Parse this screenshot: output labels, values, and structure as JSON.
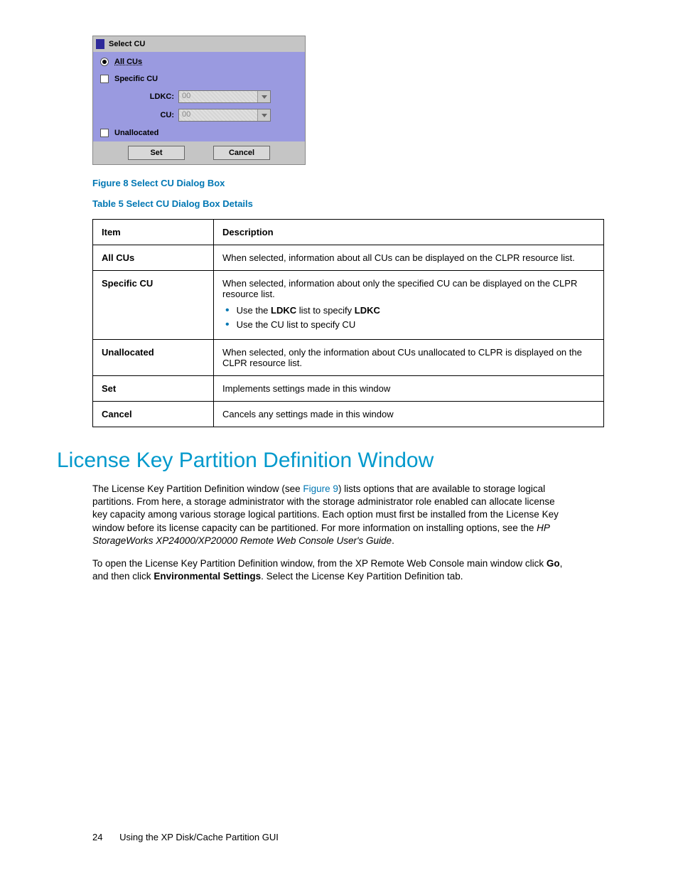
{
  "dialog": {
    "title": "Select CU",
    "opt_all": "All CUs",
    "opt_specific": "Specific CU",
    "lbl_ldkc": "LDKC:",
    "val_ldkc": "00",
    "lbl_cu": "CU:",
    "val_cu": "00",
    "opt_unalloc": "Unallocated",
    "btn_set": "Set",
    "btn_cancel": "Cancel"
  },
  "fig_caption": "Figure 8 Select CU Dialog Box",
  "tbl_caption": "Table 5 Select CU Dialog Box Details",
  "table": {
    "h_item": "Item",
    "h_desc": "Description",
    "rows": [
      {
        "item": "All CUs",
        "desc": "When selected, information about all CUs can be displayed on the CLPR resource list."
      },
      {
        "item": "Specific CU",
        "desc_intro": "When selected, information about only the specified CU can be displayed on the CLPR resource list.",
        "bullets": {
          "b1_pre": "Use the ",
          "b1_bold": "LDKC",
          "b1_mid": " list to specify ",
          "b1_bold2": "LDKC",
          "b2": "Use the CU list to specify CU"
        }
      },
      {
        "item": "Unallocated",
        "desc": "When selected, only the information about CUs unallocated to CLPR is displayed on the CLPR resource list."
      },
      {
        "item": "Set",
        "desc": "Implements settings made in this window"
      },
      {
        "item": "Cancel",
        "desc": "Cancels any settings made in this window"
      }
    ]
  },
  "section_title": "License Key Partition Definition Window",
  "para1": {
    "p1": "The License Key Partition Definition window (see ",
    "link": "Figure 9",
    "p2": ") lists options that are available to storage logical partitions. From here, a storage administrator with the storage administrator role enabled can allocate license key capacity among various storage logical partitions. Each option must first be installed from the License Key window before its license capacity can be partitioned. For more information on installing options, see the ",
    "book": "HP StorageWorks XP24000/XP20000 Remote Web Console User's Guide",
    "p3": "."
  },
  "para2": {
    "p1": "To open the License Key Partition Definition window, from the XP Remote Web Console main window click ",
    "b1": "Go",
    "p2": ", and then click ",
    "b2": "Environmental Settings",
    "p3": ". Select the License Key Partition Definition tab."
  },
  "footer": {
    "page": "24",
    "text": "Using the XP Disk/Cache Partition GUI"
  }
}
